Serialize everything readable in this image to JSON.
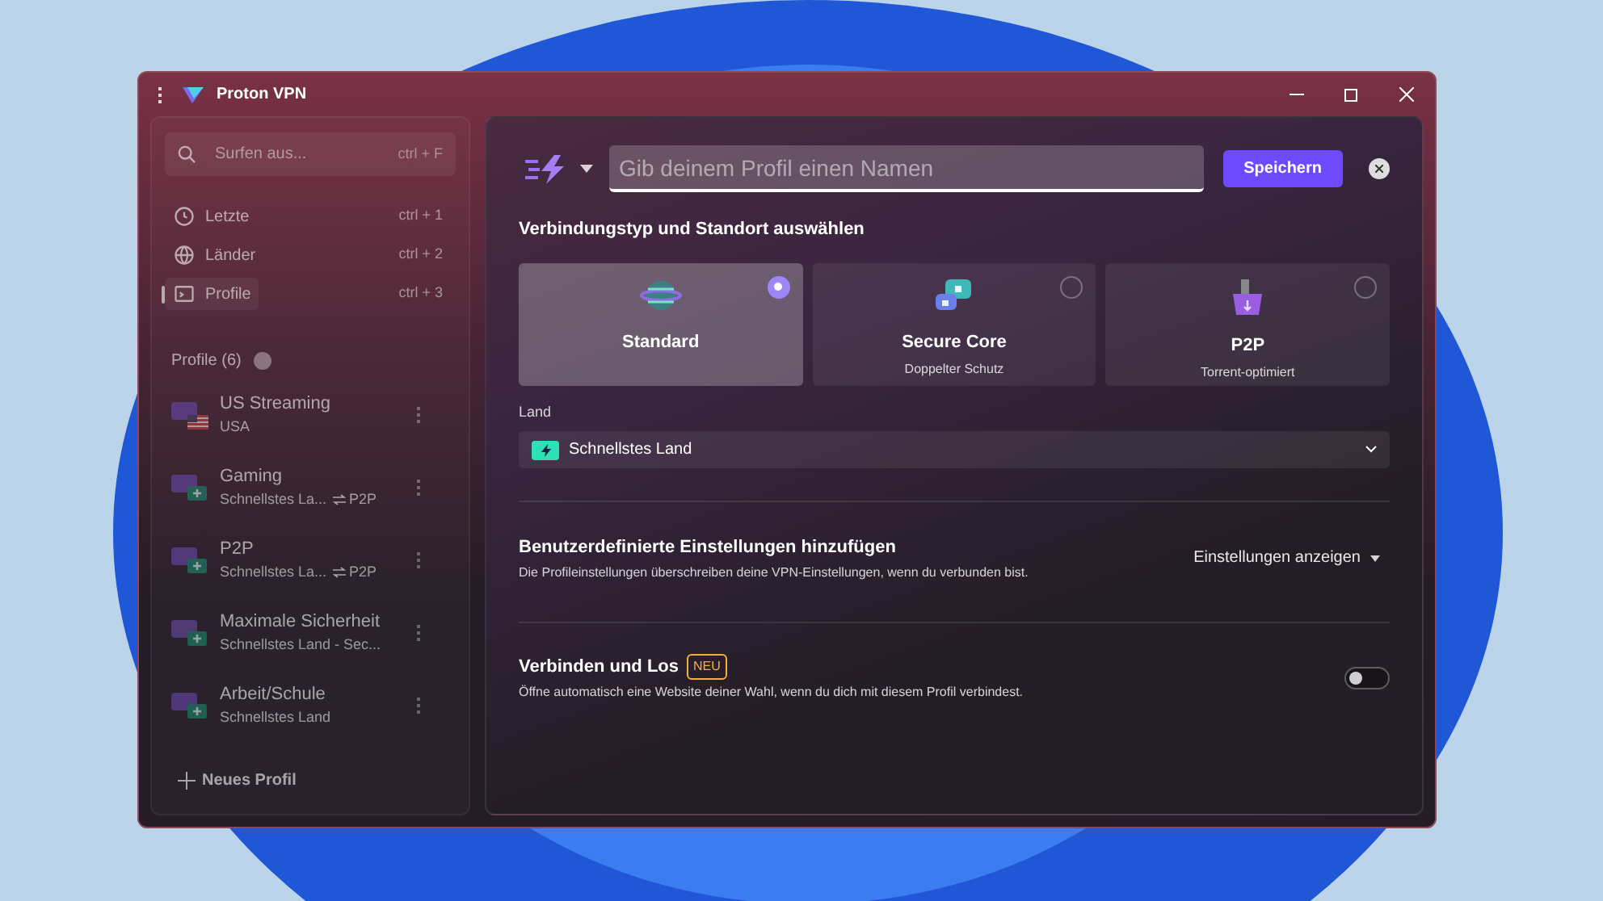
{
  "window": {
    "title": "Proton VPN"
  },
  "sidebar": {
    "dimmed": true,
    "search": {
      "placeholder": "Surfen aus...",
      "shortcut": "ctrl + F"
    },
    "nav": [
      {
        "label": "Letzte",
        "shortcut": "ctrl + 1",
        "kind": "recent",
        "selected": false
      },
      {
        "label": "Länder",
        "shortcut": "ctrl + 2",
        "kind": "countries",
        "selected": false
      },
      {
        "label": "Profile",
        "shortcut": "ctrl + 3",
        "kind": "profiles",
        "selected": true
      }
    ],
    "profiles_heading": "Profile (6)",
    "profiles": [
      {
        "name": "US Streaming",
        "detail": "USA",
        "kind": "streaming"
      },
      {
        "name": "Gaming",
        "detail": "Schnellstes La...",
        "tag": "P2P",
        "kind": "gaming"
      },
      {
        "name": "P2P",
        "detail": "Schnellstes La...",
        "tag": "P2P",
        "kind": "p2p"
      },
      {
        "name": "Maximale Sicherheit",
        "detail": "Schnellstes Land - Sec...",
        "kind": "security"
      },
      {
        "name": "Arbeit/Schule",
        "detail": "Schnellstes Land",
        "kind": "work"
      }
    ],
    "new_profile": "Neues Profil"
  },
  "editor": {
    "name_field": {
      "placeholder": "Gib deinem Profil einen Namen"
    },
    "save": "Speichern",
    "section_title": "Verbindungstyp und Standort auswählen",
    "types": [
      {
        "title": "Standard",
        "kind": "standard",
        "selected": true
      },
      {
        "title": "Secure Core",
        "subtitle": "Doppelter Schutz",
        "kind": "securecore",
        "selected": false
      },
      {
        "title": "P2P",
        "subtitle": "Torrent-optimiert",
        "kind": "p2p",
        "selected": false
      }
    ],
    "country_label": "Land",
    "country_value": "Schnellstes Land",
    "custom": {
      "title": "Benutzerdefinierte Einstellungen hinzufügen",
      "description": "Die Profileinstellungen überschreiben deine VPN-Einstellungen, wenn du verbunden bist.",
      "action": "Einstellungen anzeigen"
    },
    "connect_go": {
      "title": "Verbinden und Los",
      "badge": "NEU",
      "description": "Öffne automatisch eine Website deiner Wahl, wenn du dich mit diesem Profil verbindest.",
      "on": false
    }
  }
}
